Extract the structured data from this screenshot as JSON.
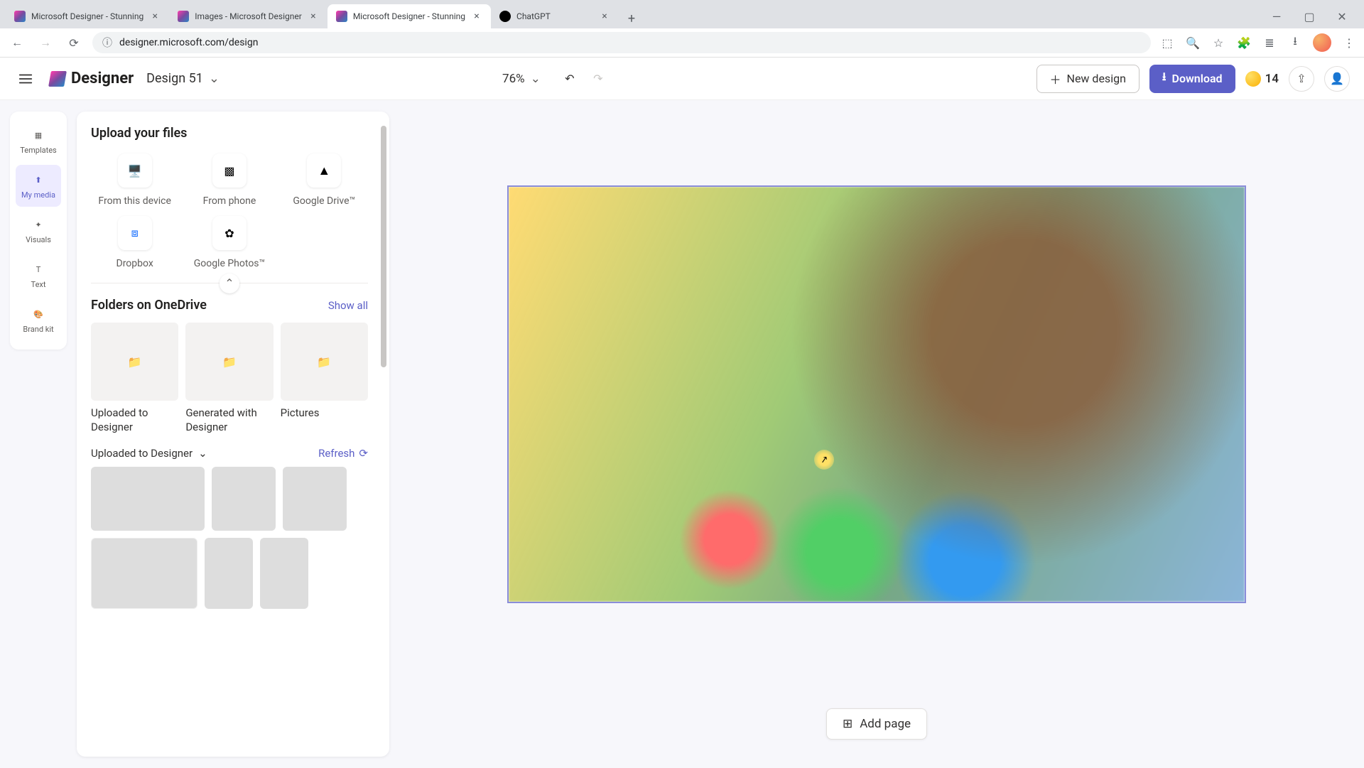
{
  "browser": {
    "tabs": [
      {
        "title": "Microsoft Designer - Stunning",
        "favicon": "designer"
      },
      {
        "title": "Images - Microsoft Designer",
        "favicon": "designer"
      },
      {
        "title": "Microsoft Designer - Stunning",
        "favicon": "designer",
        "active": true
      },
      {
        "title": "ChatGPT",
        "favicon": "chatgpt"
      }
    ],
    "url": "designer.microsoft.com/design"
  },
  "header": {
    "brand": "Designer",
    "design_name": "Design 51",
    "zoom": "76%",
    "new_design_label": "New design",
    "download_label": "Download",
    "coin_count": "14"
  },
  "left_rail": [
    {
      "label": "Templates",
      "icon": "templates"
    },
    {
      "label": "My media",
      "icon": "upload",
      "active": true
    },
    {
      "label": "Visuals",
      "icon": "visuals"
    },
    {
      "label": "Text",
      "icon": "text"
    },
    {
      "label": "Brand kit",
      "icon": "brandkit"
    }
  ],
  "panel": {
    "upload_title": "Upload your files",
    "upload_options": [
      {
        "label": "From this device",
        "icon": "device"
      },
      {
        "label": "From phone",
        "icon": "qr"
      },
      {
        "label": "Google Drive™",
        "icon": "gdrive"
      },
      {
        "label": "Dropbox",
        "icon": "dropbox"
      },
      {
        "label": "Google Photos™",
        "icon": "gphotos"
      }
    ],
    "folders_title": "Folders on OneDrive",
    "show_all": "Show all",
    "folders": [
      {
        "label": "Uploaded to Designer"
      },
      {
        "label": "Generated with Designer"
      },
      {
        "label": "Pictures"
      }
    ],
    "uploaded_dropdown": "Uploaded to Designer",
    "refresh": "Refresh"
  },
  "canvas": {
    "add_page": "Add page"
  }
}
